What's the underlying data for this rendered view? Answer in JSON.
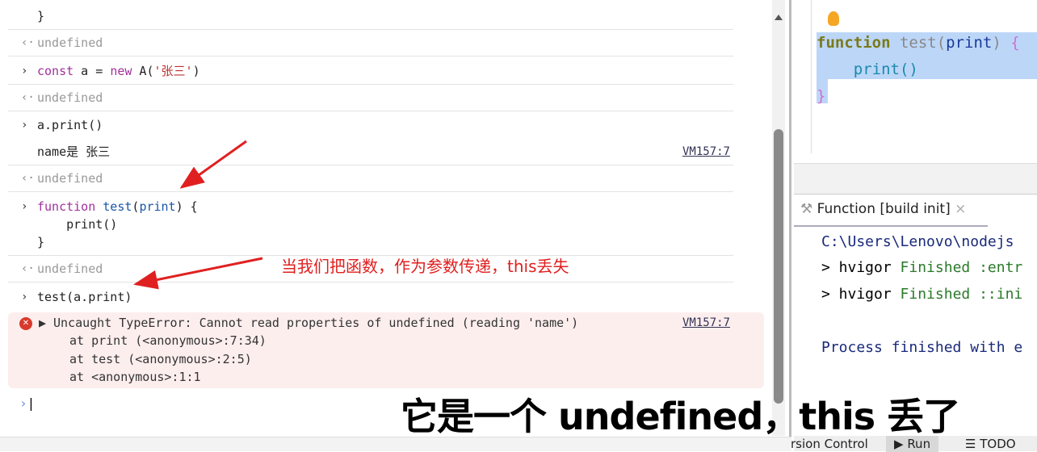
{
  "console": {
    "top_brace": "}",
    "undefined": "undefined",
    "cmd1": "const a = new A('张三')",
    "cmd1_parts": {
      "kw1": "const",
      "mid1": " a = ",
      "kw2": "new",
      "mid2": " A(",
      "str": "'张三'",
      "end": ")"
    },
    "cmd2": "a.print()",
    "log": "name是 张三",
    "log_source": "VM157:7",
    "fn_lines": [
      "function test(print) {",
      "    print()",
      "}"
    ],
    "cmd3": "test(a.print)",
    "error": {
      "message": "Uncaught TypeError: Cannot read properties of undefined (reading 'name')",
      "source": "VM157:7",
      "stack": [
        "at print (<anonymous>:7:34)",
        "at test (<anonymous>:2:5)",
        "at <anonymous>:1:1"
      ]
    }
  },
  "annotation": "当我们把函数，作为参数传递，this丢失",
  "subtitle": "它是一个 undefined，this 丢了",
  "editor": {
    "lines": [
      "function test(print) {",
      "    print()",
      "}"
    ]
  },
  "run_panel": {
    "tab": "Function [build init]",
    "lines": [
      "C:\\Users\\Lenovo\\nodejs",
      "> hvigor Finished :entr",
      "> hvigor Finished ::ini",
      "Process finished with e"
    ]
  },
  "bottom_tabs": [
    "rsion Control",
    "Run",
    "TODO"
  ],
  "colors": {
    "error_bg": "#fdeeee",
    "annotation": "#e02020",
    "selection": "#bcd6f8"
  }
}
